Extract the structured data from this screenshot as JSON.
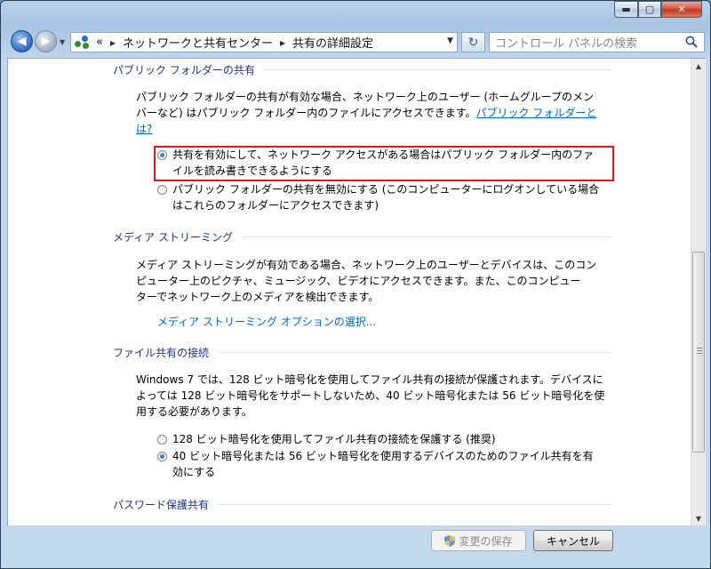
{
  "window": {
    "caption_buttons": {
      "minimize": "▬",
      "maximize": "▢",
      "close": "✕"
    }
  },
  "nav": {
    "back_glyph": "◀",
    "forward_glyph": "▶",
    "dropdown_glyph": "▼",
    "breadcrumb": {
      "overflow": "«",
      "items": [
        "ネットワークと共有センター",
        "共有の詳細設定"
      ],
      "separator": "▸"
    },
    "refresh_glyph": "↻",
    "search_placeholder": "コントロール パネルの検索"
  },
  "sections": {
    "public_folder": {
      "heading": "パブリック フォルダーの共有",
      "desc_l1": "パブリック フォルダーの共有が有効な場合、ネットワーク上のユーザー (ホームグループのメン",
      "desc_l2": "バーなど) はパブリック フォルダー内のファイルにアクセスできます。",
      "link_l1": "パブリック フォルダーと",
      "link_l2": "は?",
      "options": [
        {
          "l1": "共有を有効にして、ネットワーク アクセスがある場合はパブリック フォルダー内のファ",
          "l2": "イルを読み書きできるようにする",
          "selected": true
        },
        {
          "l1": "パブリック フォルダーの共有を無効にする (このコンピューターにログオンしている場合",
          "l2": "はこれらのフォルダーにアクセスできます)",
          "selected": false
        }
      ]
    },
    "media_streaming": {
      "heading": "メディア ストリーミング",
      "desc_l1": "メディア ストリーミングが有効である場合、ネットワーク上のユーザーとデバイスは、このコン",
      "desc_l2": "ピューター上のピクチャ、ミュージック、ビデオにアクセスできます。また、このコンピュー",
      "desc_l3": "ターでネットワーク上のメディアを検出できます。",
      "link": "メディア ストリーミング オプションの選択..."
    },
    "file_sharing": {
      "heading": "ファイル共有の接続",
      "desc_l1": "Windows 7 では、128 ビット暗号化を使用してファイル共有の接続が保護されます。デバイスに",
      "desc_l2": "よっては 128 ビット暗号化をサポートしないため、40 ビット暗号化または 56 ビット暗号化を使",
      "desc_l3": "用する必要があります。",
      "options": [
        {
          "l1": "128 ビット暗号化を使用してファイル共有の接続を保護する (推奨)",
          "l2": "",
          "selected": false
        },
        {
          "l1": "40 ビット暗号化または 56 ビット暗号化を使用するデバイスのためのファイル共有を有",
          "l2": "効にする",
          "selected": true
        }
      ]
    },
    "password": {
      "heading": "パスワード保護共有"
    }
  },
  "footer": {
    "save_label": "変更の保存",
    "cancel_label": "キャンセル"
  },
  "scrollbar": {
    "up": "▲",
    "down": "▼"
  },
  "colors": {
    "heading": "#1e3287",
    "link": "#0066cc",
    "highlight_box": "#e0151b"
  }
}
